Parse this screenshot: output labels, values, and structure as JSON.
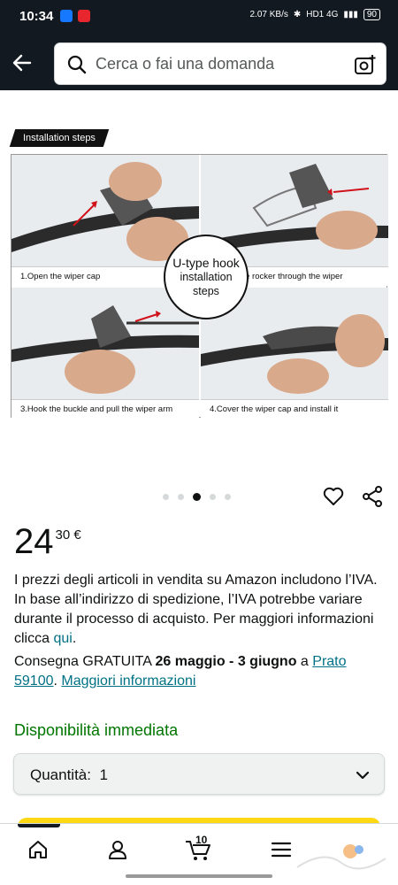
{
  "status_bar": {
    "time": "10:34",
    "speed": "2.07 KB/s",
    "network": "HD1 4G",
    "battery": "90"
  },
  "search": {
    "placeholder": "Cerca o fai una domanda"
  },
  "gallery": {
    "tag": "Installation steps",
    "steps": [
      "1.Open the wiper cap",
      "2.Push the rocker through the wiper",
      "3.Hook the buckle and pull the wiper arm",
      "4.Cover the wiper cap and install it"
    ],
    "center_line1": "U-type hook",
    "center_line2": "installation steps",
    "dots_total": 5,
    "dots_active": 3
  },
  "product": {
    "price_int": "24",
    "price_frac": "30 €",
    "vat_text": "I prezzi degli articoli in vendita su Amazon includono l’IVA. In base all’indirizzo di spedizione, l’IVA potrebbe variare durante il processo di acquisto. Per maggiori informazioni clicca ",
    "vat_link": "qui",
    "vat_end": ".",
    "delivery_prefix": "Consegna GRATUITA ",
    "delivery_dates": "26 maggio - 3 giugno",
    "delivery_mid": " a ",
    "delivery_location": "Prato 59100",
    "delivery_sep": ". ",
    "delivery_more": "Maggiori informazioni",
    "availability": "Disponibilità immediata",
    "quantity_label": "Quantità:",
    "quantity_value": "1"
  },
  "nav": {
    "cart_count": "10"
  },
  "colors": {
    "header_bg": "#131921",
    "link": "#007185",
    "in_stock": "#007600",
    "buy_button": "#ffd814"
  },
  "icons": [
    "back-arrow-icon",
    "search-icon",
    "camera-icon",
    "heart-icon",
    "share-icon",
    "chevron-down-icon",
    "home-icon",
    "account-icon",
    "cart-icon",
    "menu-icon"
  ]
}
